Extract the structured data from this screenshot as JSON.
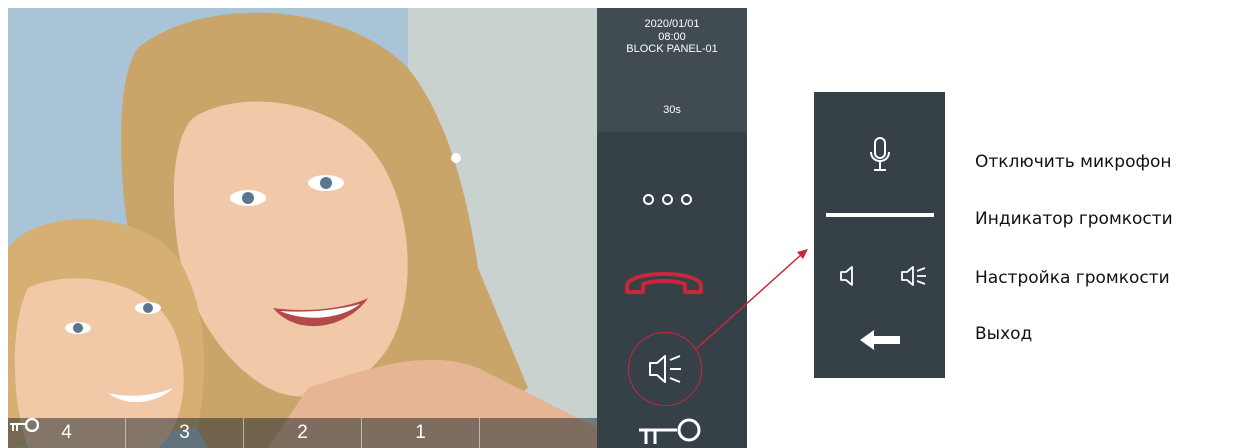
{
  "status": {
    "date": "2020/01/01",
    "time": "08:00",
    "device": "BLOCK PANEL-01",
    "timer": "30s"
  },
  "unlock_buttons": [
    {
      "label": "4",
      "icon": "key-icon"
    },
    {
      "label": "3",
      "icon": "key-icon"
    },
    {
      "label": "2",
      "icon": "key-icon"
    },
    {
      "label": "1",
      "icon": "key-icon"
    },
    {
      "label": "",
      "icon": "key-icon"
    }
  ],
  "controls": {
    "more_icon": "more-dots-icon",
    "hangup_icon": "hangup-phone-icon",
    "speaker_icon": "speaker-volume-icon",
    "unlock_icon": "key-icon"
  },
  "submenu": {
    "mic_icon": "microphone-icon",
    "volume_down_icon": "volume-down-icon",
    "volume_up_icon": "volume-up-icon",
    "exit_icon": "arrow-left-icon"
  },
  "legend": {
    "mute": "Отключить микрофон",
    "indicator": "Индикатор громкости",
    "adjust": "Настройка громкости",
    "exit": "Выход"
  },
  "colors": {
    "panel": "#364047",
    "accent_red": "#c8283a"
  }
}
